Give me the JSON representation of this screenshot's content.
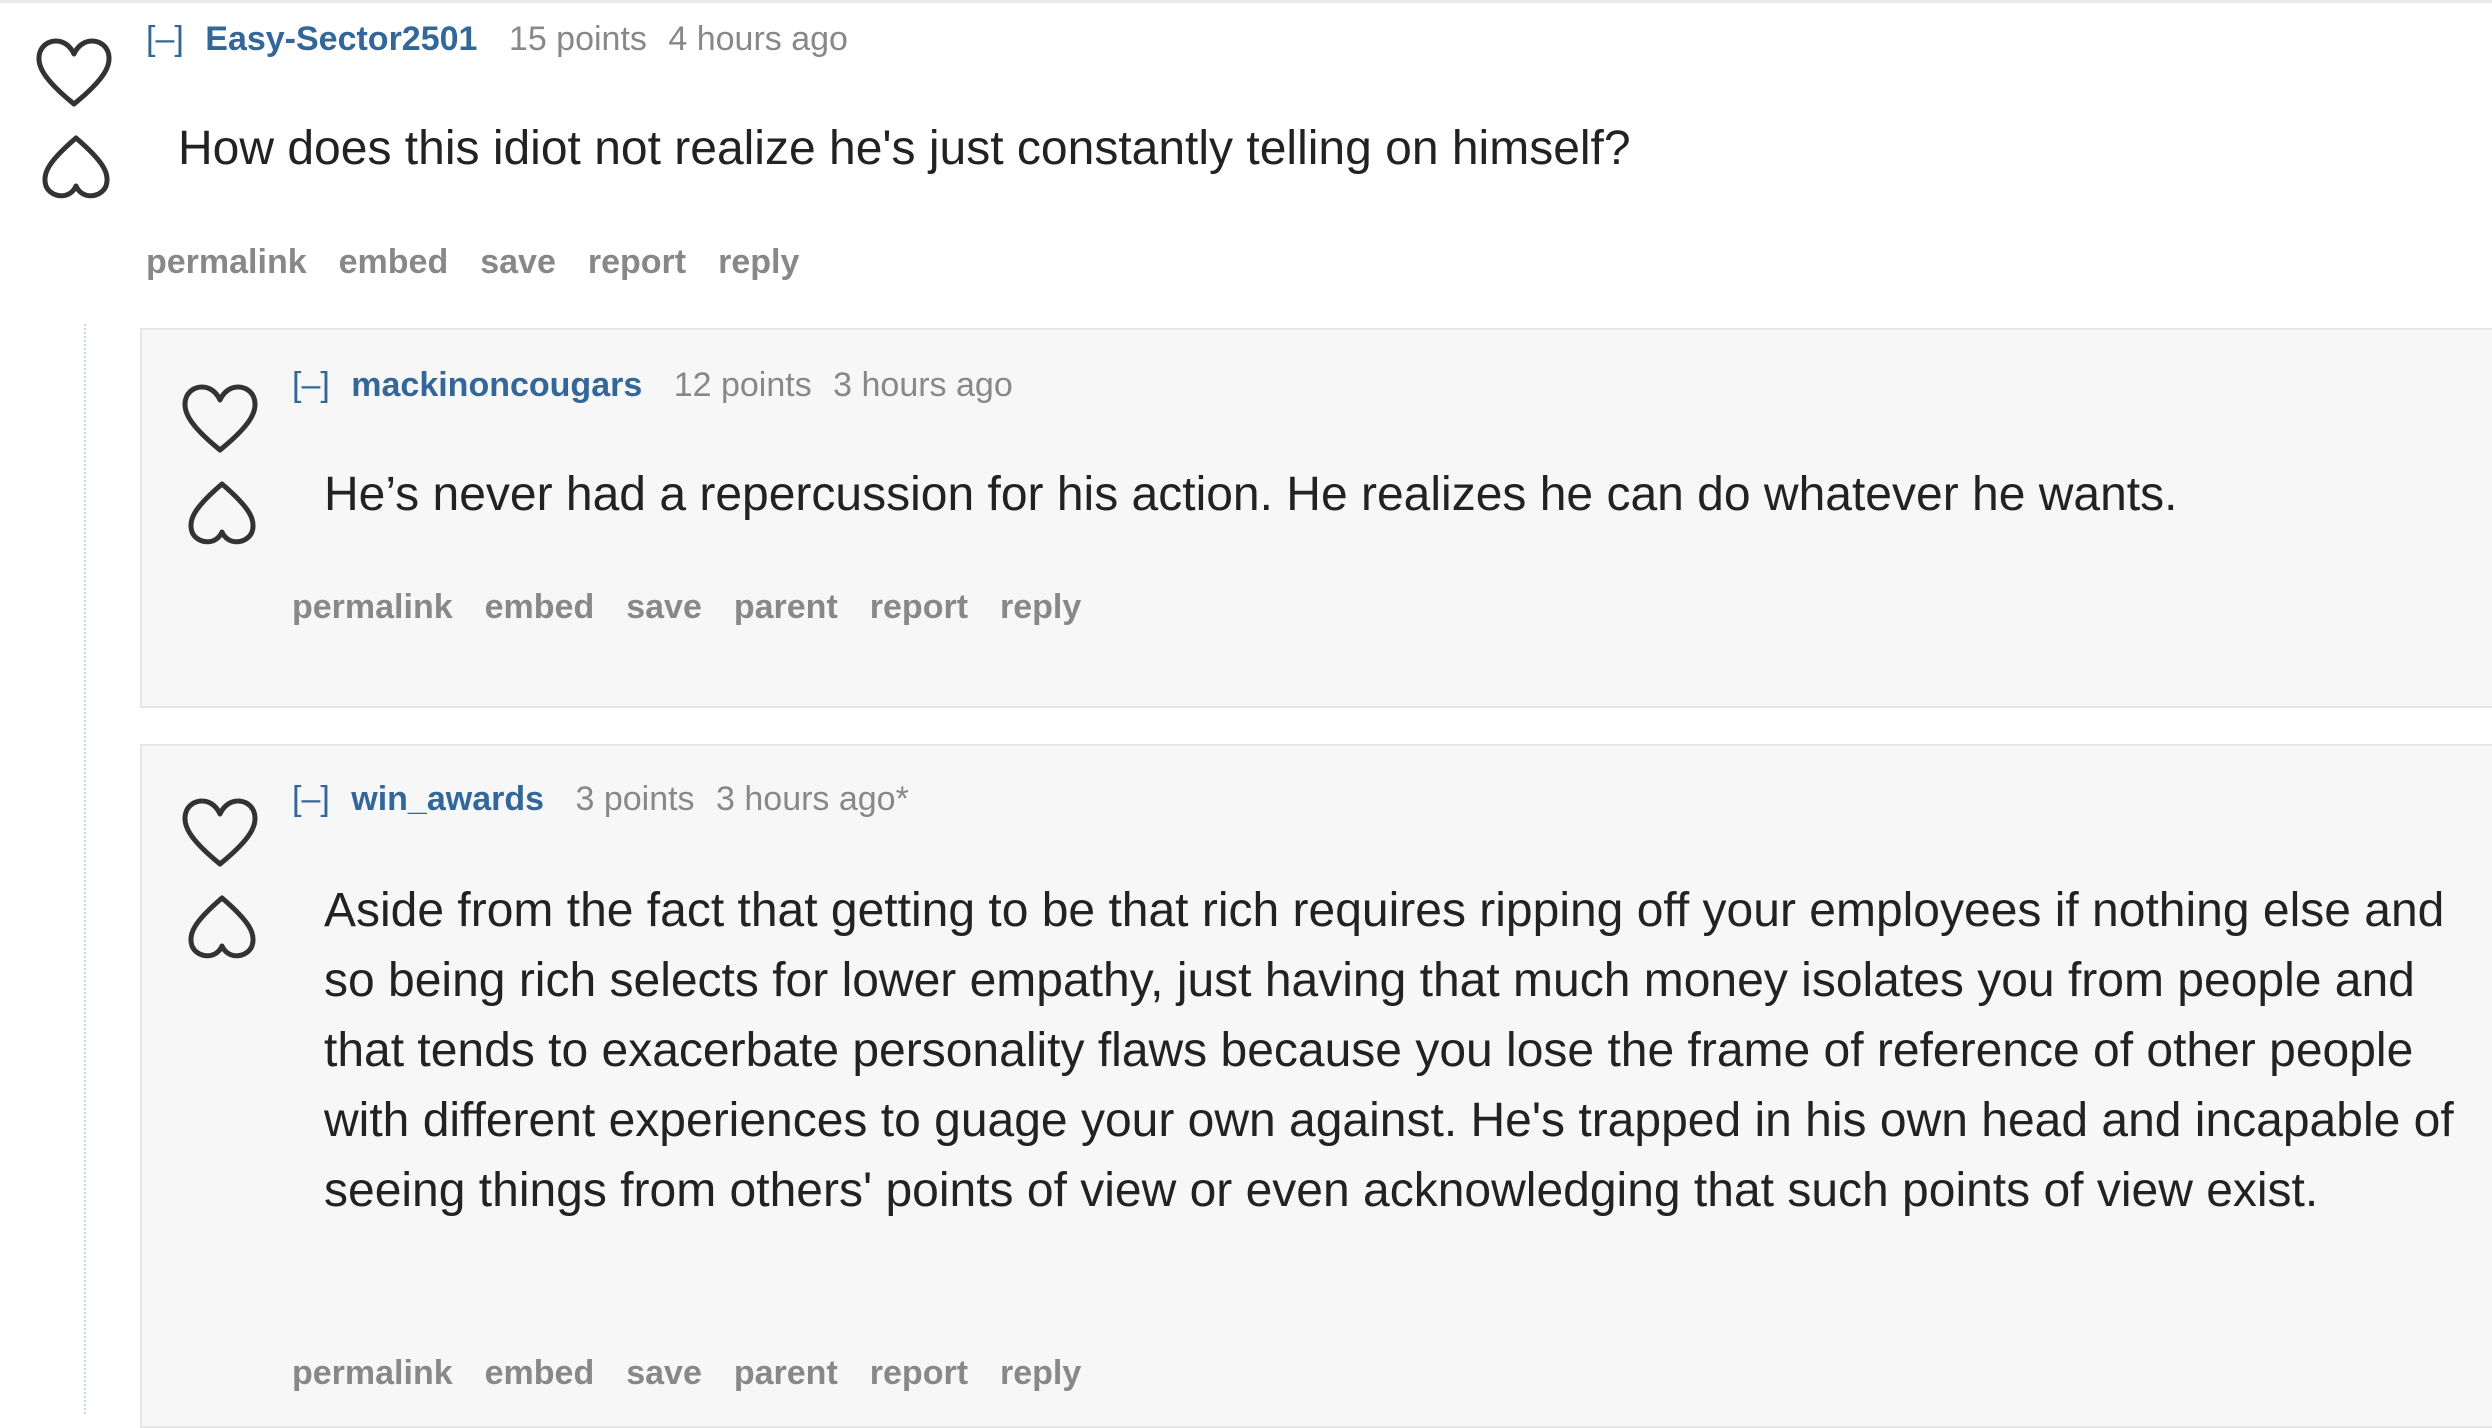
{
  "comments": [
    {
      "toggle": "[–]",
      "author": "Easy-Sector2501",
      "score": "15 points",
      "time": "4 hours ago",
      "body": "How does this idiot not realize he's just constantly telling on himself?",
      "actions": [
        "permalink",
        "embed",
        "save",
        "report",
        "reply"
      ]
    },
    {
      "toggle": "[–]",
      "author": "mackinoncougars",
      "score": "12 points",
      "time": "3 hours ago",
      "body": "He’s never had a repercussion for his action. He realizes he can do whatever he wants.",
      "actions": [
        "permalink",
        "embed",
        "save",
        "parent",
        "report",
        "reply"
      ]
    },
    {
      "toggle": "[–]",
      "author": "win_awards",
      "score": "3 points",
      "time": "3 hours ago*",
      "body": "Aside from the fact that getting to be that rich requires ripping off your employees if nothing else and so being rich selects for lower empathy, just having that much money isolates you from people and that tends to exacerbate personality flaws because you lose the frame of reference of other people with different experiences to guage your own against. He's trapped in his own head and incapable of seeing things from others' points of view or even acknowledging that such points of view exist.",
      "actions": [
        "permalink",
        "embed",
        "save",
        "parent",
        "report",
        "reply"
      ]
    }
  ],
  "icons": {
    "upvote": "heart-outline-icon",
    "downvote": "heart-inverted-icon"
  },
  "colors": {
    "author": "#336699",
    "meta": "#888888",
    "body": "#222222",
    "nested_bg": "#f7f7f7"
  }
}
